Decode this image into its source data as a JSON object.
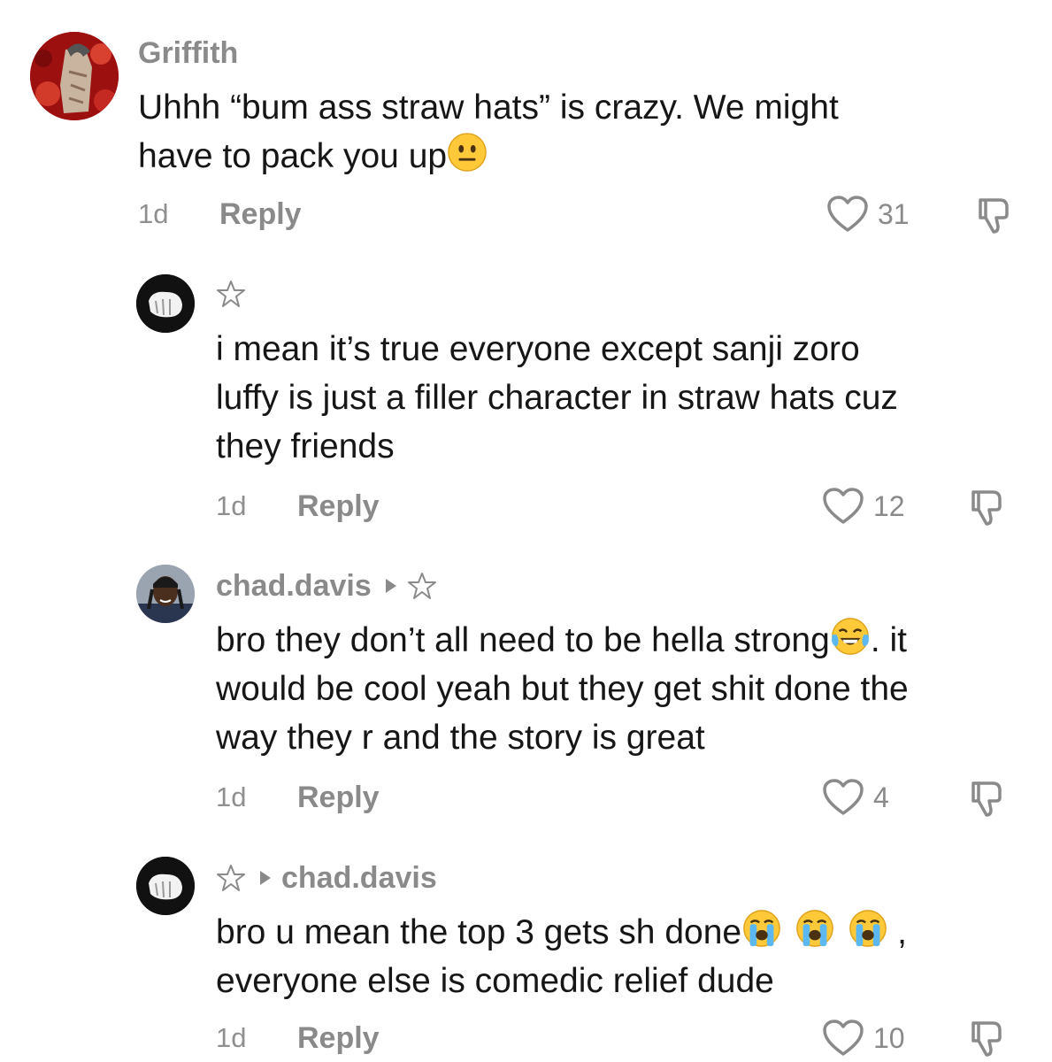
{
  "comments": [
    {
      "username": "Griffith",
      "text_lines": [
        "Uhhh “bum ass straw hats” is crazy. We might",
        "have to pack you up"
      ],
      "emoji": "neutral-face",
      "time": "1d",
      "reply_label": "Reply",
      "likes": "31"
    },
    {
      "username": "",
      "text_lines": [
        "i mean it’s true everyone except sanji zoro",
        "luffy is just a filler character in straw hats cuz",
        "they friends"
      ],
      "time": "1d",
      "reply_label": "Reply",
      "likes": "12"
    },
    {
      "username": "chad.davis",
      "text_line1_before": "bro they don’t all need to be hella strong",
      "text_line1_after": ". it",
      "text_lines_rest": [
        "would be cool yeah but they get shit done the",
        "way they r and the story is great"
      ],
      "emoji": "tears-of-joy",
      "time": "1d",
      "reply_label": "Reply",
      "likes": "4"
    },
    {
      "reply_to": "chad.davis",
      "text_line1_before": "bro u mean the top 3 gets sh done",
      "text_line1_after": ",",
      "text_lines_rest": [
        "everyone else is comedic relief dude"
      ],
      "emoji": "loudly-crying",
      "time": "1d",
      "reply_label": "Reply",
      "likes": "10"
    }
  ],
  "colors": {
    "text": "#161616",
    "meta": "#8a8a8a"
  }
}
